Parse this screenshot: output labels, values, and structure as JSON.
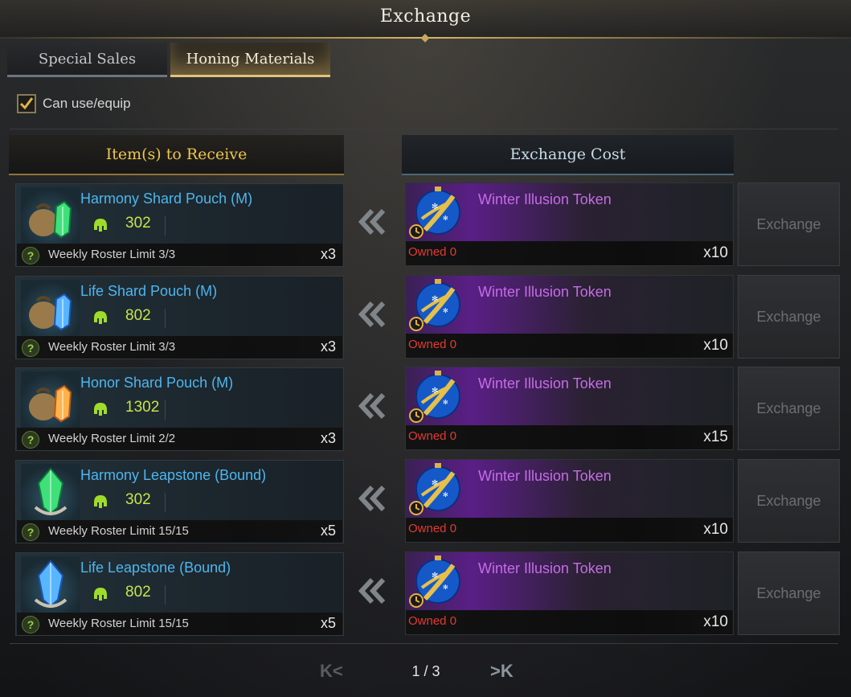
{
  "window": {
    "title": "Exchange"
  },
  "tabs": [
    {
      "label": "Special Sales",
      "active": false
    },
    {
      "label": "Honing Materials",
      "active": true
    }
  ],
  "filter": {
    "label": "Can use/equip",
    "checked": true
  },
  "columns": {
    "receive": "Item(s) to Receive",
    "cost": "Exchange Cost"
  },
  "rows": [
    {
      "item": "Harmony Shard Pouch (M)",
      "value": "302",
      "limit": "Weekly Roster Limit 3/3",
      "qty": "x3",
      "icon": "green-shard-pouch-icon",
      "token": "Winter Illusion Token",
      "owned": "Owned 0",
      "cost_qty": "x10",
      "button": "Exchange"
    },
    {
      "item": "Life Shard Pouch (M)",
      "value": "802",
      "limit": "Weekly Roster Limit 3/3",
      "qty": "x3",
      "icon": "blue-shard-pouch-icon",
      "token": "Winter Illusion Token",
      "owned": "Owned 0",
      "cost_qty": "x10",
      "button": "Exchange"
    },
    {
      "item": "Honor Shard Pouch (M)",
      "value": "1302",
      "limit": "Weekly Roster Limit 2/2",
      "qty": "x3",
      "icon": "orange-shard-pouch-icon",
      "token": "Winter Illusion Token",
      "owned": "Owned 0",
      "cost_qty": "x15",
      "button": "Exchange"
    },
    {
      "item": "Harmony Leapstone (Bound)",
      "value": "302",
      "limit": "Weekly Roster Limit 15/15",
      "qty": "x5",
      "icon": "green-leapstone-icon",
      "token": "Winter Illusion Token",
      "owned": "Owned 0",
      "cost_qty": "x10",
      "button": "Exchange"
    },
    {
      "item": "Life Leapstone (Bound)",
      "value": "802",
      "limit": "Weekly Roster Limit 15/15",
      "qty": "x5",
      "icon": "blue-leapstone-icon",
      "token": "Winter Illusion Token",
      "owned": "Owned 0",
      "cost_qty": "x10",
      "button": "Exchange"
    }
  ],
  "pagination": {
    "text": "1 / 3",
    "first": "K<",
    "last": ">K"
  },
  "colors": {
    "item_name": "#4db6ee",
    "value": "#c6e54a",
    "token": "#c56ce7",
    "owned": "#e23b32",
    "gold": "#f0c64b"
  }
}
